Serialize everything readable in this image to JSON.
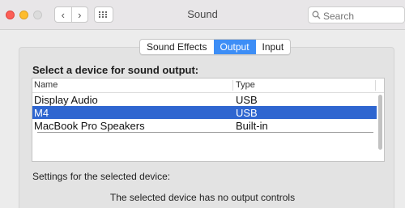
{
  "window": {
    "title": "Sound",
    "search_placeholder": "Search",
    "back_glyph": "‹",
    "forward_glyph": "›"
  },
  "tabs": [
    {
      "label": "Sound Effects",
      "active": false
    },
    {
      "label": "Output",
      "active": true
    },
    {
      "label": "Input",
      "active": false
    }
  ],
  "output": {
    "heading": "Select a device for sound output:",
    "columns": [
      "Name",
      "Type"
    ],
    "devices": [
      {
        "name": "Display Audio",
        "type": "USB",
        "selected": false
      },
      {
        "name": "M4",
        "type": "USB",
        "selected": true
      },
      {
        "name": "MacBook Pro Speakers",
        "type": "Built-in",
        "selected": false
      }
    ],
    "settings_label": "Settings for the selected device:",
    "no_controls_text": "The selected device has no output controls"
  },
  "colors": {
    "selection": "#2f66d0",
    "tab_active": "#3d8ef6",
    "close": "#fc5f57",
    "minimize": "#fdbc2e"
  }
}
